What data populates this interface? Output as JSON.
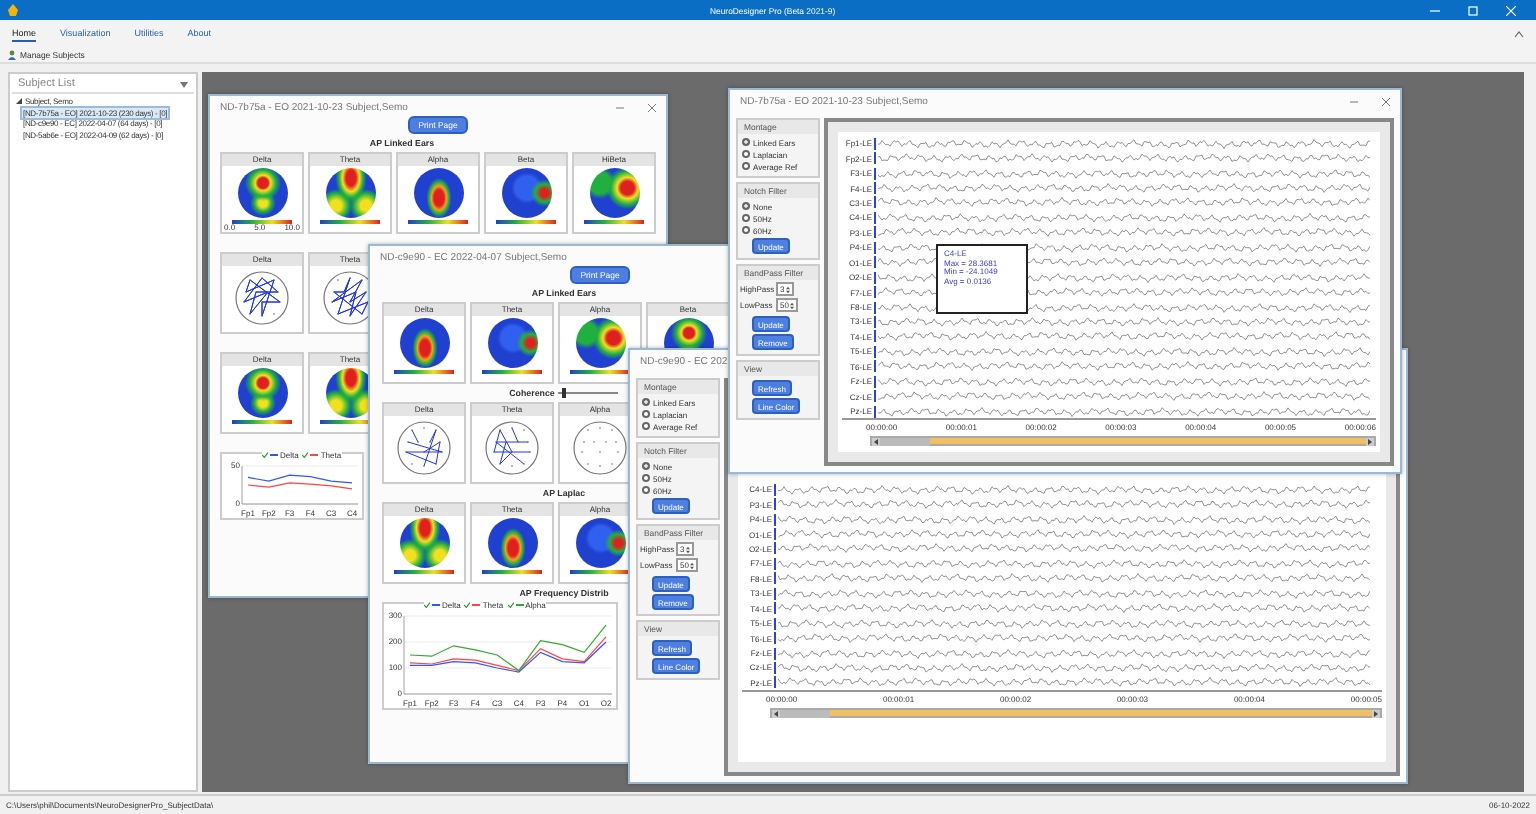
{
  "window": {
    "title": "NeuroDesigner Pro (Beta 2021-9)"
  },
  "menu": [
    {
      "label": "Home",
      "selected": true
    },
    {
      "label": "Visualization",
      "selected": false
    },
    {
      "label": "Utilities",
      "selected": false
    },
    {
      "label": "About",
      "selected": false
    }
  ],
  "toolbar": [
    {
      "label": "Manage Subjects"
    }
  ],
  "subject_list": {
    "title": "Subject List",
    "tree": [
      {
        "label": "Subject, Semo",
        "expanded": true,
        "children": [
          {
            "label": "[ND-7b75a - EO] 2021-10-23 (230 days) - [0]",
            "selected": true
          },
          {
            "label": "[ND-c9e90 - EC] 2022-04-07 (64 days) - [0]",
            "selected": false
          },
          {
            "label": "[ND-5ab6e - EO] 2022-04-09 (62 days) - [0]",
            "selected": false
          }
        ]
      }
    ]
  },
  "documents": [
    {
      "kind": "report",
      "title": "ND-7b75a  - EO  2021-10-23  Subject,Semo",
      "print_button": "Print Page",
      "sections": [
        {
          "kind": "topo",
          "title": "AP Linked Ears",
          "maps": [
            {
              "label": "Delta",
              "scale": [
                "0.0",
                "5.0",
                "10.0"
              ]
            },
            {
              "label": "Theta"
            },
            {
              "label": "Alpha"
            },
            {
              "label": "Beta"
            },
            {
              "label": "HiBeta"
            }
          ]
        },
        {
          "kind": "coherence",
          "maps": [
            {
              "label": "Delta"
            },
            {
              "label": "Theta"
            }
          ]
        },
        {
          "kind": "topo",
          "maps": [
            {
              "label": "Delta"
            },
            {
              "label": "Theta"
            }
          ]
        },
        {
          "kind": "chart",
          "chart_data": {
            "type": "line",
            "categories": [
              "Fp1",
              "Fp2",
              "F3",
              "F4",
              "C3",
              "C4"
            ],
            "ylim": [
              0,
              50
            ],
            "yticks": [
              0,
              50
            ],
            "legend": "top",
            "series": [
              {
                "name": "Delta",
                "color": "#3355ff",
                "values": [
                  35,
                  30,
                  38,
                  36,
                  30,
                  28
                ]
              },
              {
                "name": "Theta",
                "color": "#ff4444",
                "values": [
                  25,
                  22,
                  28,
                  26,
                  24,
                  20
                ]
              }
            ]
          }
        }
      ]
    },
    {
      "kind": "report",
      "title": "ND-c9e90  - EC  2022-04-07  Subject,Semo",
      "print_button": "Print Page",
      "sections": [
        {
          "kind": "topo",
          "title": "AP Linked Ears",
          "maps": [
            {
              "label": "Delta"
            },
            {
              "label": "Theta"
            },
            {
              "label": "Alpha"
            },
            {
              "label": "Beta"
            }
          ]
        },
        {
          "kind": "coherence",
          "title": "Coherence",
          "level": 0.1,
          "maps": [
            {
              "label": "Delta"
            },
            {
              "label": "Theta"
            },
            {
              "label": "Alpha"
            }
          ]
        },
        {
          "kind": "topo",
          "title": "AP Laplac",
          "maps": [
            {
              "label": "Delta"
            },
            {
              "label": "Theta"
            },
            {
              "label": "Alpha"
            }
          ]
        },
        {
          "kind": "chart",
          "title": "AP Frequency Distrib",
          "chart_data": {
            "type": "line",
            "categories": [
              "Fp1",
              "Fp2",
              "F3",
              "F4",
              "C3",
              "C4",
              "P3",
              "P4",
              "O1",
              "O2"
            ],
            "ylim": [
              0,
              300
            ],
            "yticks": [
              0,
              100,
              200,
              300
            ],
            "legend": "top",
            "series": [
              {
                "name": "Delta",
                "color": "#3355ff",
                "values": [
                  110,
                  110,
                  125,
                  120,
                  100,
                  85,
                  160,
                  125,
                  120,
                  200
                ]
              },
              {
                "name": "Theta",
                "color": "#ff4444",
                "values": [
                  120,
                  115,
                  135,
                  130,
                  110,
                  90,
                  175,
                  135,
                  125,
                  220
                ]
              },
              {
                "name": "Alpha",
                "color": "#33aa33",
                "values": [
                  150,
                  145,
                  185,
                  170,
                  150,
                  90,
                  205,
                  190,
                  160,
                  265
                ]
              }
            ]
          }
        }
      ]
    },
    {
      "kind": "eeg",
      "title": "ND-c9e90  - EC  202",
      "montage": {
        "title": "Montage",
        "options": [
          {
            "label": "Linked Ears",
            "selected": true
          },
          {
            "label": "Laplacian",
            "selected": false
          },
          {
            "label": "Average Ref",
            "selected": false
          }
        ]
      },
      "notch_filter": {
        "title": "Notch Filter",
        "options": [
          {
            "label": "None",
            "selected": true
          },
          {
            "label": "50Hz",
            "selected": false
          },
          {
            "label": "60Hz",
            "selected": false
          }
        ],
        "button": "Update"
      },
      "bandpass_filter": {
        "title": "BandPass Filter",
        "fields": [
          {
            "label": "HighPass",
            "value": "3"
          },
          {
            "label": "LowPass",
            "value": "50"
          }
        ],
        "buttons": [
          "Update",
          "Remove"
        ]
      },
      "view": {
        "title": "View",
        "buttons": [
          "Refresh",
          "Line Color"
        ]
      },
      "channels": [
        "C4-LE",
        "P3-LE",
        "P4-LE",
        "O1-LE",
        "O2-LE",
        "F7-LE",
        "F8-LE",
        "T3-LE",
        "T4-LE",
        "T5-LE",
        "T6-LE",
        "Fz-LE",
        "Cz-LE",
        "Pz-LE"
      ],
      "time_labels": [
        "00:00:00",
        "00:00:01",
        "00:00:02",
        "00:00:03",
        "00:00:04",
        "00:00:05"
      ]
    },
    {
      "kind": "eeg",
      "title": "ND-7b75a  - EO  2021-10-23  Subject,Semo",
      "montage": {
        "title": "Montage",
        "options": [
          {
            "label": "Linked Ears",
            "selected": true
          },
          {
            "label": "Laplacian",
            "selected": false
          },
          {
            "label": "Average Ref",
            "selected": false
          }
        ]
      },
      "notch_filter": {
        "title": "Notch Filter",
        "options": [
          {
            "label": "None",
            "selected": true
          },
          {
            "label": "50Hz",
            "selected": false
          },
          {
            "label": "60Hz",
            "selected": false
          }
        ],
        "button": "Update"
      },
      "bandpass_filter": {
        "title": "BandPass Filter",
        "fields": [
          {
            "label": "HighPass",
            "value": "3"
          },
          {
            "label": "LowPass",
            "value": "50"
          }
        ],
        "buttons": [
          "Update",
          "Remove"
        ]
      },
      "view": {
        "title": "View",
        "buttons": [
          "Refresh",
          "Line Color"
        ]
      },
      "channels": [
        "Fp1-LE",
        "Fp2-LE",
        "F3-LE",
        "F4-LE",
        "C3-LE",
        "C4-LE",
        "P3-LE",
        "P4-LE",
        "O1-LE",
        "O2-LE",
        "F7-LE",
        "F8-LE",
        "T3-LE",
        "T4-LE",
        "T5-LE",
        "T6-LE",
        "Fz-LE",
        "Cz-LE",
        "Pz-LE"
      ],
      "tooltip": [
        "C4-LE",
        "Max = 28.3681",
        "Min = -24.1049",
        "Avg = 0.0136"
      ],
      "time_labels": [
        "00:00:00",
        "00:00:01",
        "00:00:02",
        "00:00:03",
        "00:00:04",
        "00:00:05",
        "00:00:06"
      ]
    }
  ],
  "status_bar": {
    "path": "C:\\Users\\phil\\Documents\\NeuroDesignerPro_SubjectData\\",
    "date": "06-10-2022"
  }
}
